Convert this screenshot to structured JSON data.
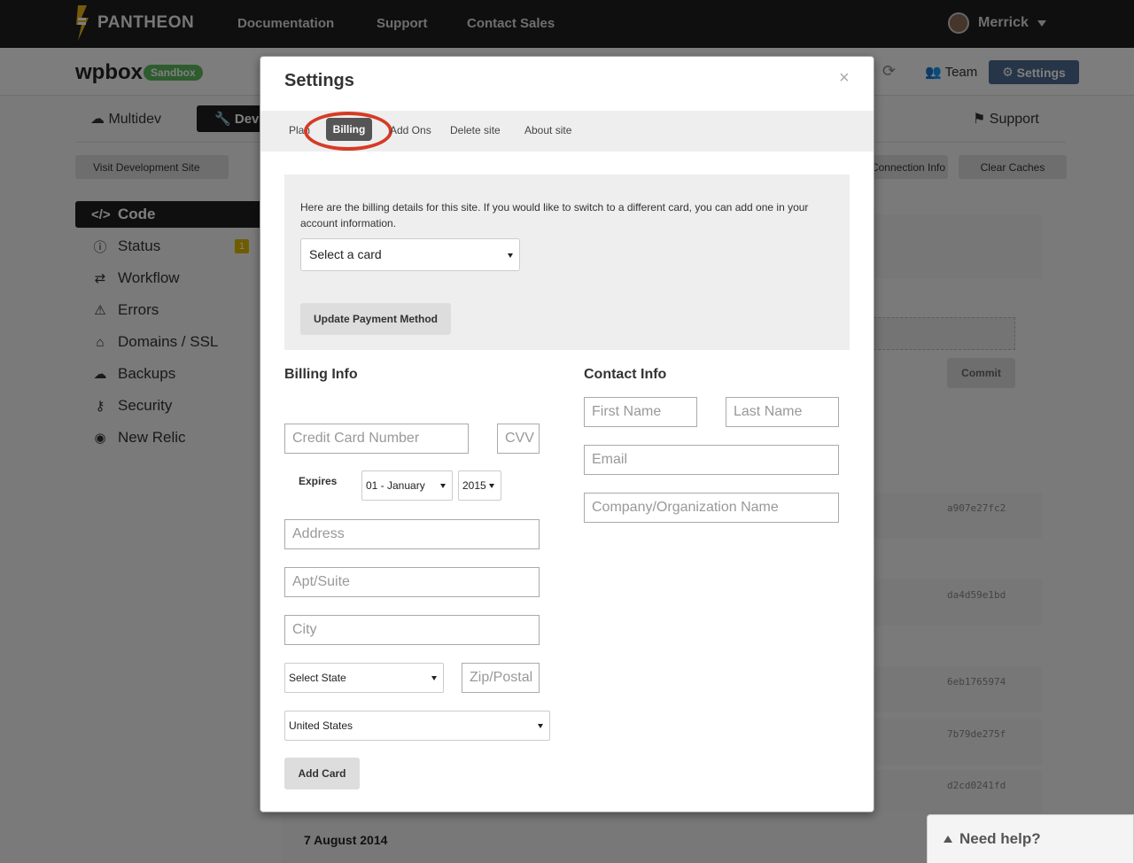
{
  "topnav": {
    "logo": "PANTHEON",
    "links": [
      "Documentation",
      "Support",
      "Contact Sales"
    ],
    "user": "Merrick"
  },
  "site": {
    "name": "wpbox",
    "badge": "Sandbox",
    "team_label": "Team",
    "settings_label": "Settings",
    "tabs": {
      "multidev": "Multidev",
      "dev": "Dev",
      "support": "Support"
    },
    "visit_label": "Visit Development Site",
    "connection_label": "Connection Info",
    "clear_caches_label": "Clear Caches",
    "commit_label": "Commit",
    "date_heading": "7 August 2014",
    "hashes": [
      "a907e27fc2",
      "da4d59e1bd",
      "6eb1765974",
      "7b79de275f",
      "d2cd0241fd"
    ]
  },
  "sidebar": {
    "items": [
      {
        "label": "Code",
        "icon": "code-icon"
      },
      {
        "label": "Status",
        "icon": "info-icon",
        "badge": "1"
      },
      {
        "label": "Workflow",
        "icon": "workflow-icon"
      },
      {
        "label": "Errors",
        "icon": "warning-icon"
      },
      {
        "label": "Domains / SSL",
        "icon": "home-icon"
      },
      {
        "label": "Backups",
        "icon": "cloud-icon"
      },
      {
        "label": "Security",
        "icon": "key-icon"
      },
      {
        "label": "New Relic",
        "icon": "eye-icon"
      }
    ]
  },
  "modal": {
    "title": "Settings",
    "close": "×",
    "tabs": [
      "Plan",
      "Billing",
      "Add Ons",
      "Delete site",
      "About site"
    ],
    "active_tab": "Billing",
    "info_text": "Here are the billing details for this site. If you would like to switch to a different card, you can add one in your account information.",
    "select_card": "Select a card",
    "update_button": "Update Payment Method",
    "billing": {
      "heading": "Billing Info",
      "cc_placeholder": "Credit Card Number",
      "cvv_placeholder": "CVV",
      "expires_label": "Expires",
      "month": "01 - January",
      "year": "2015",
      "address_placeholder": "Address",
      "apt_placeholder": "Apt/Suite",
      "city_placeholder": "City",
      "state": "Select State",
      "zip_placeholder": "Zip/Postal",
      "country": "United States",
      "add_card": "Add Card"
    },
    "contact": {
      "heading": "Contact Info",
      "first_name": "First Name",
      "last_name": "Last Name",
      "email": "Email",
      "company": "Company/Organization Name"
    }
  },
  "help": {
    "label": "Need help?"
  },
  "colors": {
    "highlight_ring": "#d63b25",
    "navbar": "#1e1e1e",
    "sandbox_green": "#5cb85c",
    "settings_blue": "#4d6a8f"
  }
}
